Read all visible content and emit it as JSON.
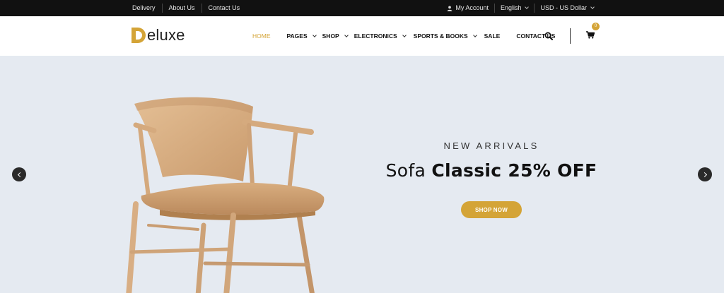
{
  "topbar": {
    "links": [
      "Delivery",
      "About Us",
      "Contact Us"
    ],
    "account": "My Account",
    "language": "English",
    "currency": "USD - US Dollar"
  },
  "logo": {
    "initial": "D",
    "text": "eluxe"
  },
  "nav": {
    "items": [
      {
        "label": "HOME",
        "active": true,
        "dropdown": false
      },
      {
        "label": "PAGES",
        "dropdown": true
      },
      {
        "label": "SHOP",
        "dropdown": true
      },
      {
        "label": "ELECTRONICS",
        "dropdown": true
      },
      {
        "label": "SPORTS & BOOKS",
        "dropdown": true
      },
      {
        "label": "SALE",
        "dropdown": false
      },
      {
        "label": "CONTACT US",
        "dropdown": false
      }
    ]
  },
  "header_icons": {
    "search": "search-icon",
    "cart": "cart-icon",
    "cart_count": "0"
  },
  "hero": {
    "subtitle": "NEW ARRIVALS",
    "title_light": "Sofa",
    "title_bold": "Classic 25% OFF",
    "button": "SHOP NOW",
    "image": "wooden-chair"
  },
  "colors": {
    "accent": "#d4a437",
    "topbar_bg": "#111111",
    "hero_bg": "#e5eaf1"
  }
}
